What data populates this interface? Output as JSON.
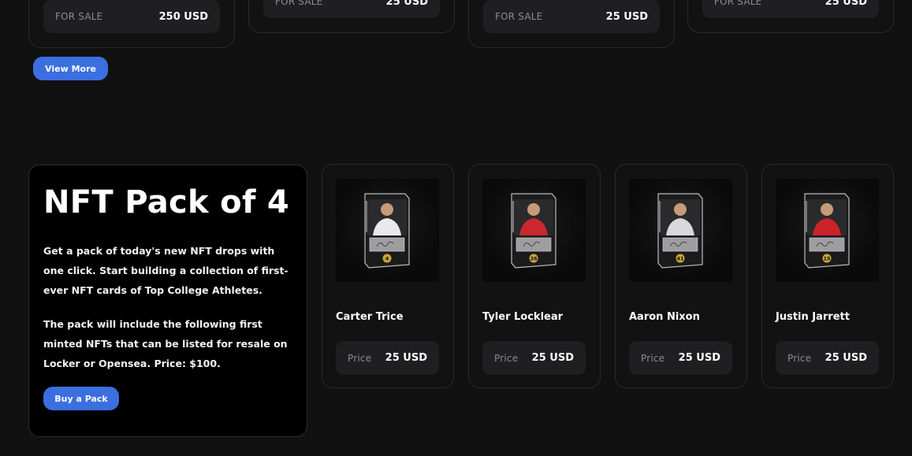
{
  "top_cards": [
    {
      "status": "FOR SALE",
      "price": "250 USD"
    },
    {
      "status": "FOR SALE",
      "price": "25 USD"
    },
    {
      "status": "FOR SALE",
      "price": "25 USD"
    },
    {
      "status": "FOR SALE",
      "price": "25 USD"
    }
  ],
  "view_more_label": "View More",
  "pack": {
    "title": "NFT Pack of 4",
    "description_1": "Get a pack of today's new NFT drops with one click. Start building a collection of first-ever NFT cards of Top College Athletes.",
    "description_2": "The pack will include the following first minted NFTs that can be listed for resale on Locker or Opensea. Price: $100.",
    "button_label": "Buy a Pack"
  },
  "players": [
    {
      "name": "Carter Trice",
      "price_label": "Price",
      "price": "25 USD",
      "number": "4",
      "jersey_color": "#e9e9ec"
    },
    {
      "name": "Tyler Locklear",
      "price_label": "Price",
      "price": "25 USD",
      "number": "26",
      "jersey_color": "#c8282e"
    },
    {
      "name": "Aaron Nixon",
      "price_label": "Price",
      "price": "25 USD",
      "number": "41",
      "jersey_color": "#d9d9dc"
    },
    {
      "name": "Justin Jarrett",
      "price_label": "Price",
      "price": "25 USD",
      "number": "15",
      "jersey_color": "#cc2229"
    }
  ],
  "colors": {
    "accent": "#3b6fe0",
    "badge_gold": "#c9a23c"
  }
}
